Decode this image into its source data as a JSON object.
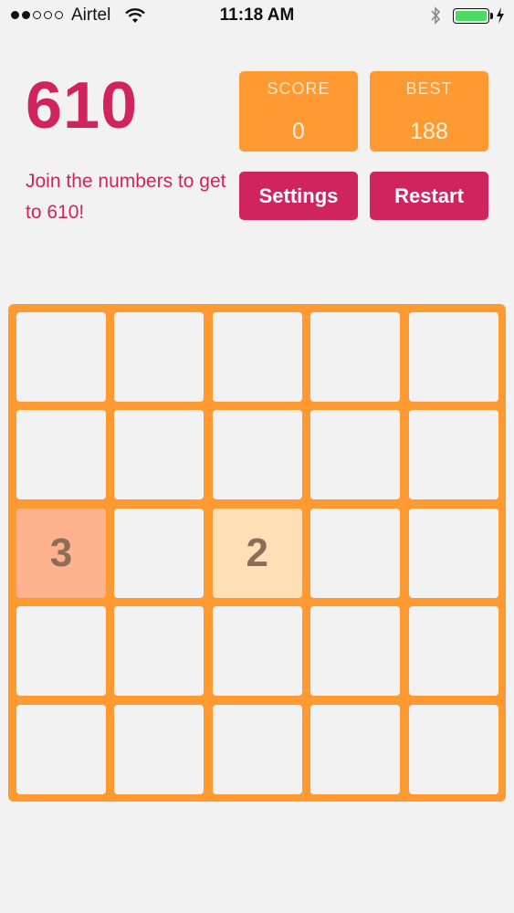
{
  "status_bar": {
    "carrier": "Airtel",
    "time": "11:18 AM",
    "signal_bars_filled": 2,
    "signal_bars_total": 5,
    "battery_level": 1.0
  },
  "header": {
    "title": "610",
    "subtitle": "Join the numbers to get to 610!"
  },
  "scores": {
    "score_label": "SCORE",
    "score_value": "0",
    "best_label": "BEST",
    "best_value": "188"
  },
  "buttons": {
    "settings": "Settings",
    "restart": "Restart"
  },
  "board": {
    "size": 5,
    "tiles": [
      [
        "",
        "",
        "",
        "",
        ""
      ],
      [
        "",
        "",
        "",
        "",
        ""
      ],
      [
        "3",
        "",
        "2",
        "",
        ""
      ],
      [
        "",
        "",
        "",
        "",
        ""
      ],
      [
        "",
        "",
        "",
        "",
        ""
      ]
    ]
  },
  "colors": {
    "accent": "#d0245f",
    "board": "#ff9a32",
    "tile_3": "#ffb28e",
    "tile_2": "#ffe0b6"
  }
}
